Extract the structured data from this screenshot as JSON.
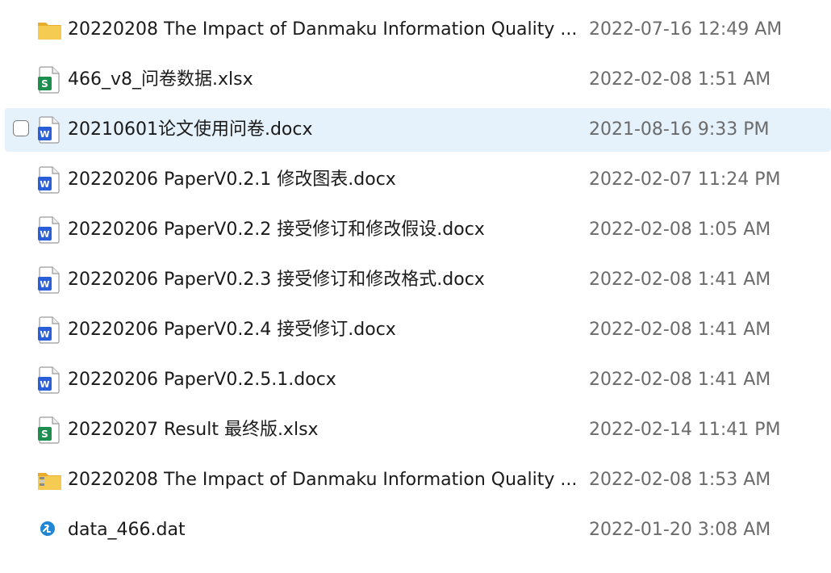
{
  "files": [
    {
      "name": "20220208 The Impact of Danmaku Information Quality ...",
      "date": "2022-07-16 12:49 AM",
      "icon": "folder-icon",
      "selected": false
    },
    {
      "name": "466_v8_问卷数据.xlsx",
      "date": "2022-02-08 1:51 AM",
      "icon": "excel-file-icon",
      "selected": false
    },
    {
      "name": "20210601论文使用问卷.docx",
      "date": "2021-08-16 9:33 PM",
      "icon": "word-file-icon",
      "selected": true
    },
    {
      "name": "20220206 PaperV0.2.1 修改图表.docx",
      "date": "2022-02-07 11:24 PM",
      "icon": "word-file-icon",
      "selected": false
    },
    {
      "name": "20220206 PaperV0.2.2 接受修订和修改假设.docx",
      "date": "2022-02-08 1:05 AM",
      "icon": "word-file-icon",
      "selected": false
    },
    {
      "name": "20220206 PaperV0.2.3 接受修订和修改格式.docx",
      "date": "2022-02-08 1:41 AM",
      "icon": "word-file-icon",
      "selected": false
    },
    {
      "name": "20220206 PaperV0.2.4 接受修订.docx",
      "date": "2022-02-08 1:41 AM",
      "icon": "word-file-icon",
      "selected": false
    },
    {
      "name": "20220206 PaperV0.2.5.1.docx",
      "date": "2022-02-08 1:41 AM",
      "icon": "word-file-icon",
      "selected": false
    },
    {
      "name": "20220207 Result 最终版.xlsx",
      "date": "2022-02-14 11:41 PM",
      "icon": "excel-file-icon",
      "selected": false
    },
    {
      "name": "20220208 The Impact of Danmaku Information Quality ...",
      "date": "2022-02-08 1:53 AM",
      "icon": "zip-folder-icon",
      "selected": false
    },
    {
      "name": "data_466.dat",
      "date": "2022-01-20 3:08 AM",
      "icon": "dat-file-icon",
      "selected": false
    }
  ],
  "colors": {
    "selected_row": "#e5f1fb",
    "folder": "#f3c64a",
    "excel": "#1e8e4e",
    "word": "#2b5fd9",
    "dat": "#1f87d6",
    "date_text": "#6b6b6b"
  }
}
